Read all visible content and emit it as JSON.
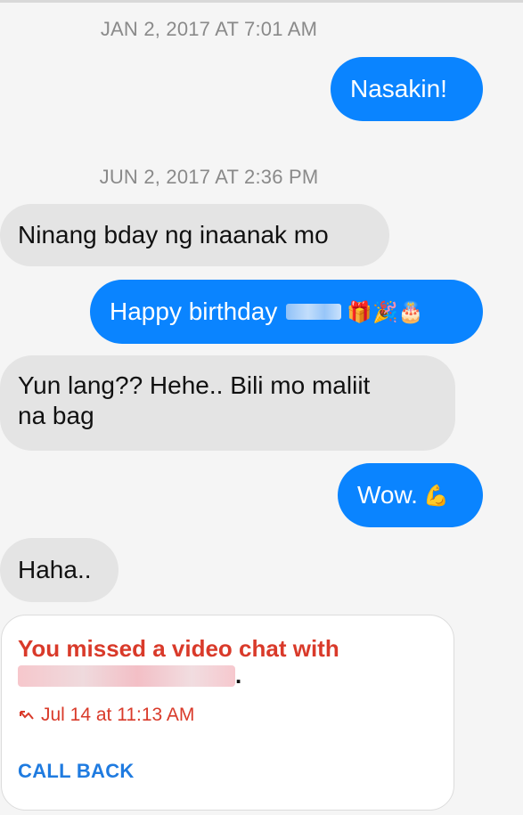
{
  "thread": {
    "timestamps": [
      "JAN 2, 2017 AT 7:01 AM",
      "JUN 2, 2017 AT 2:36 PM"
    ],
    "messages": [
      {
        "from": "me",
        "text": "Nasakin!"
      },
      {
        "from": "them",
        "text": "Ninang bday ng inaanak mo"
      },
      {
        "from": "me",
        "text": "Happy birthday",
        "emoji": "🎁🎉🎂"
      },
      {
        "from": "them",
        "line1": "Yun lang?? Hehe.. Bili mo maliit",
        "line2": "na bag"
      },
      {
        "from": "me",
        "text": "Wow.",
        "emoji": "💪"
      },
      {
        "from": "them",
        "text": "Haha.."
      }
    ]
  },
  "missed_call": {
    "title": "You missed a video chat with",
    "period": ".",
    "time": "Jul 14 at 11:13 AM",
    "action": "CALL BACK",
    "accent_color": "#d93a2a",
    "action_color": "#1f7be0",
    "icon": "missed-call-arrow-icon"
  },
  "colors": {
    "outgoing_bubble": "#0a84ff",
    "incoming_bubble": "#e4e4e4",
    "background": "#f5f5f5"
  }
}
